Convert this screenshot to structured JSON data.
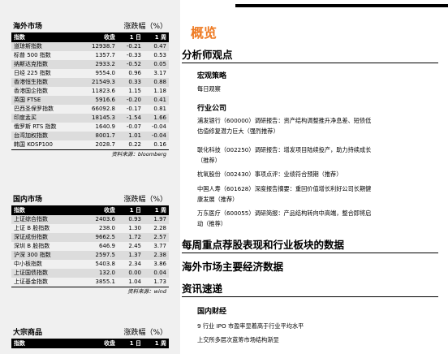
{
  "overseas": {
    "title": "海外市场",
    "unit": "涨跌幅（%）",
    "columns": [
      "指数",
      "收盘",
      "1 日",
      "1 周"
    ],
    "rows": [
      [
        "道琼斯指数",
        "12938.7",
        "-0.21",
        "0.47"
      ],
      [
        "标普 500 指数",
        "1357.7",
        "-0.33",
        "0.53"
      ],
      [
        "纳斯达克指数",
        "2933.2",
        "-0.52",
        "0.05"
      ],
      [
        "日经 225 指数",
        "9554.0",
        "0.96",
        "3.17"
      ],
      [
        "香港恒生指数",
        "21549.3",
        "0.33",
        "0.88"
      ],
      [
        "香港国企指数",
        "11823.6",
        "1.15",
        "1.18"
      ],
      [
        "英国 FTSE",
        "5916.6",
        "-0.20",
        "0.41"
      ],
      [
        "巴西圣保罗指数",
        "66092.8",
        "-0.17",
        "0.81"
      ],
      [
        "印度孟买",
        "18145.3",
        "-1.54",
        "1.66"
      ],
      [
        "俄罗斯 RTS 指数",
        "1640.9",
        "-0.07",
        "-0.04"
      ],
      [
        "台湾加权指数",
        "8001.7",
        "1.01",
        "-0.04"
      ],
      [
        "韩国 KOSP100",
        "2028.7",
        "0.22",
        "0.16"
      ]
    ],
    "source": "资料来源：bloomberg"
  },
  "domestic": {
    "title": "国内市场",
    "unit": "涨跌幅（%）",
    "columns": [
      "指数",
      "收盘",
      "1 日",
      "1 周"
    ],
    "rows": [
      [
        "上证综合指数",
        "2403.6",
        "0.93",
        "1.97"
      ],
      [
        "上证 B 股指数",
        "238.0",
        "1.30",
        "2.28"
      ],
      [
        "深证成份指数",
        "9662.5",
        "1.72",
        "2.57"
      ],
      [
        "深圳 B 股指数",
        "646.9",
        "2.45",
        "3.77"
      ],
      [
        "沪深 300 指数",
        "2597.5",
        "1.37",
        "2.38"
      ],
      [
        "中小板指数",
        "5403.8",
        "2.34",
        "3.86"
      ],
      [
        "上证国债指数",
        "132.0",
        "0.00",
        "0.04"
      ],
      [
        "上证基金指数",
        "3855.1",
        "1.04",
        "1.73"
      ]
    ],
    "source": "资料来源：wind"
  },
  "commodities": {
    "title": "大宗商品",
    "unit": "涨跌幅（%）",
    "columns": [
      "指数",
      "收盘",
      "1 日",
      "1 周"
    ]
  },
  "overview": "概览",
  "analyst": {
    "title": "分析师观点",
    "macro_title": "宏观策略",
    "macro_items": [
      "每日观察"
    ],
    "industry_title": "行业公司",
    "industry_items": [
      [
        "浦发银行（600000）调研报告：资产结构调整推升净息差、短债低",
        "估值修复潜力巨大（强烈推荐）"
      ],
      [
        "联化科技（002250）调研报告：增发项目陆续投产，助力持续成长",
        "（推荐）"
      ],
      [
        "杭氧股份（002430）事项点评：业绩符合预期（推荐）"
      ],
      [
        "中国人寿（601628）深度报告摘要：重回价值增长利好公司长期健",
        "康发展（推荐）"
      ],
      [
        "万东医疗（600055）调研简报：产品结构转向中高端，整合即将启",
        "动（推荐）"
      ]
    ]
  },
  "weekly": "每周重点荐股表现和行业板块的数据",
  "overseas_data": "海外市场主要经济数据",
  "news": {
    "title": "资讯速递",
    "domestic_title": "国内财经",
    "items": [
      "9 行业 IPO 市盈率显着高于行业平均水平",
      "上交所多层次蓝筹市场结构渐显"
    ]
  }
}
